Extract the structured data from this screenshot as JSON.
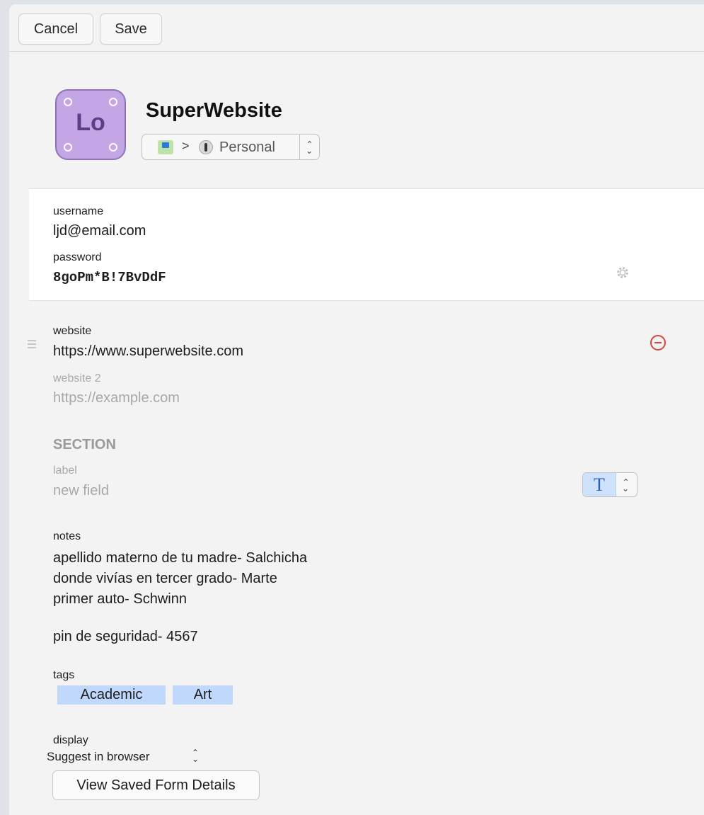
{
  "toolbar": {
    "cancel_label": "Cancel",
    "save_label": "Save"
  },
  "item": {
    "title": "SuperWebsite",
    "icon_text": "Lo",
    "icon_color": "#c4a6e6",
    "breadcrumb_separator": ">",
    "vault_name": "Personal",
    "stepper_glyph": "⌃⌄"
  },
  "credentials": {
    "username_label": "username",
    "username_value": "ljd@email.com",
    "password_label": "password",
    "password_value": "8goPm*B!7BvDdF",
    "password_generator_icon": "gear-icon"
  },
  "websites": [
    {
      "label": "website",
      "value": "https://www.superwebsite.com"
    },
    {
      "label": "website 2",
      "placeholder": "https://example.com"
    }
  ],
  "section": {
    "heading": "SECTION",
    "field_label_placeholder": "label",
    "field_value_placeholder": "new field",
    "field_type_glyph": "T"
  },
  "notes": {
    "label": "notes",
    "lines": [
      "apellido materno de tu madre- Salchicha",
      "donde vivías en tercer grado- Marte",
      "primer auto- Schwinn",
      "",
      "pin de seguridad- 4567"
    ]
  },
  "tags": {
    "label": "tags",
    "items": [
      "Academic",
      "Art"
    ],
    "tag_color": "#bfd8fb"
  },
  "display": {
    "label": "display",
    "selected": "Suggest in browser",
    "caret": "⌃⌄"
  },
  "form_details_button": "View Saved Form Details",
  "colors": {
    "remove_accent": "#d9463b",
    "type_button_accent": "#cfe2fb"
  }
}
